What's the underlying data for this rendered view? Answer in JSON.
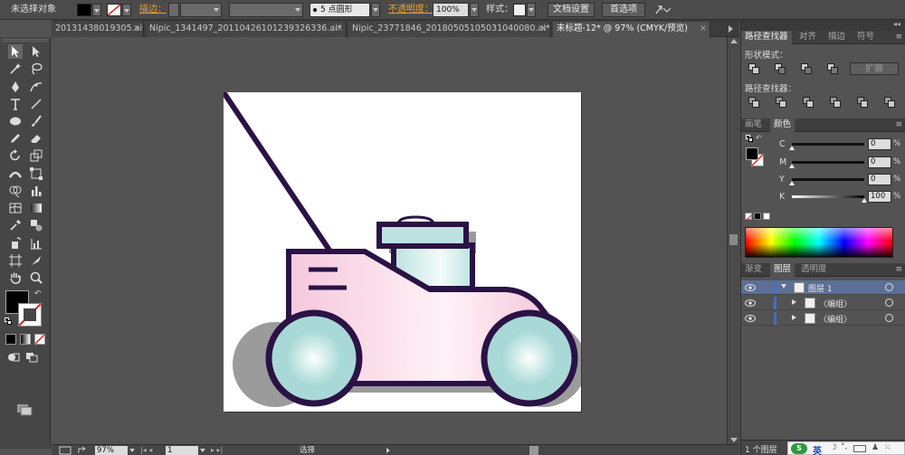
{
  "control_bar": {
    "no_selection": "未选择对象",
    "stroke_label": "描边：",
    "brush_label": "5 点圆形",
    "opacity_label": "不透明度：",
    "opacity_value": "100%",
    "style_label": "样式：",
    "doc_setup": "文档设置",
    "preferences": "首选项"
  },
  "tabs": [
    {
      "label": "20131438019305.ai*",
      "close": "×"
    },
    {
      "label": "Nipic_1341497_20110426101239326336.ai*",
      "close": "×"
    },
    {
      "label": "Nipic_23771846_20180505105031040080.ai*",
      "close": "×"
    },
    {
      "label": "未标题-12* @ 97% (CMYK/预览)",
      "close": "×"
    }
  ],
  "status": {
    "zoom": "97%",
    "page": "1",
    "tool": "选择"
  },
  "pathfinder_panel": {
    "tabs": [
      "路径查找器",
      "对齐",
      "描边",
      "符号"
    ],
    "shape_modes": "形状模式：",
    "pathfinders": "路径查找器：",
    "expand": "扩展"
  },
  "color_panel": {
    "tabs": [
      "画笔",
      "颜色"
    ],
    "channels": [
      {
        "name": "C",
        "value": "0",
        "pct": "%",
        "level": 0
      },
      {
        "name": "M",
        "value": "0",
        "pct": "%",
        "level": 0
      },
      {
        "name": "Y",
        "value": "0",
        "pct": "%",
        "level": 0
      },
      {
        "name": "K",
        "value": "100",
        "pct": "%",
        "level": 1
      }
    ]
  },
  "layers_panel": {
    "tabs": [
      "渐变",
      "图层",
      "透明度"
    ],
    "layers": [
      {
        "name": "图层 1",
        "indent": 0
      },
      {
        "name": "〈编组〉",
        "indent": 1
      },
      {
        "name": "〈编组〉",
        "indent": 1
      }
    ],
    "count": "1 个图层"
  },
  "ime": {
    "lang": "英"
  },
  "colors": {
    "outline": "#2a1245",
    "body_pink": "#f5c7dc",
    "wheel_teal": "#a9d9d6",
    "shadow": "#9b9b9b"
  }
}
